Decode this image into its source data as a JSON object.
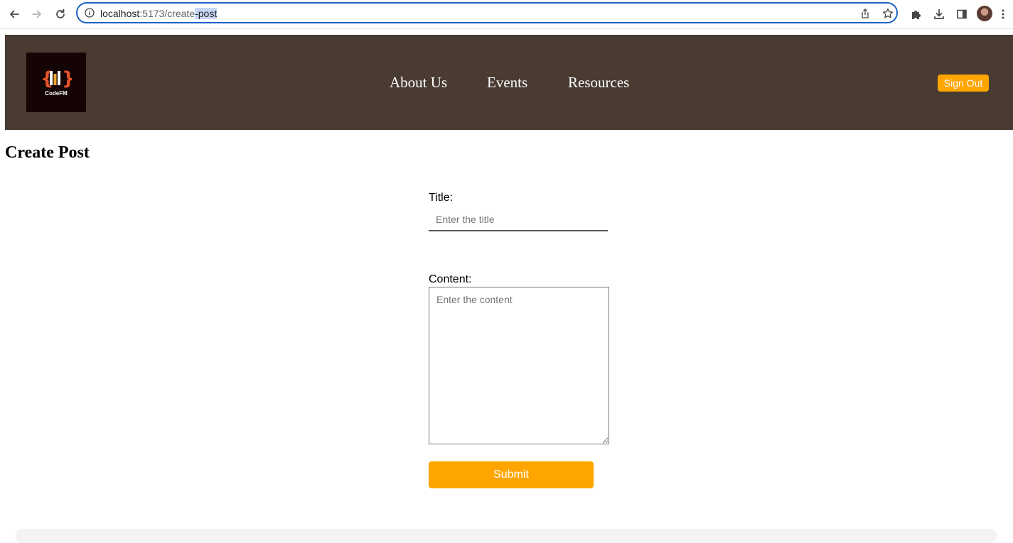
{
  "browser": {
    "url_host": "localhost",
    "url_path_plain": ":5173/create",
    "url_path_selected": "-post"
  },
  "header": {
    "logo_text": "CodeFM",
    "nav": [
      "About Us",
      "Events",
      "Resources"
    ],
    "sign_out_label": "Sign Out"
  },
  "page": {
    "title": "Create Post"
  },
  "form": {
    "title_label": "Title:",
    "title_placeholder": "Enter the title",
    "content_label": "Content:",
    "content_placeholder": "Enter the content",
    "submit_label": "Submit"
  },
  "colors": {
    "header_bg": "#493b32",
    "accent": "#ffa500",
    "omnibox_border": "#1a62c7"
  }
}
